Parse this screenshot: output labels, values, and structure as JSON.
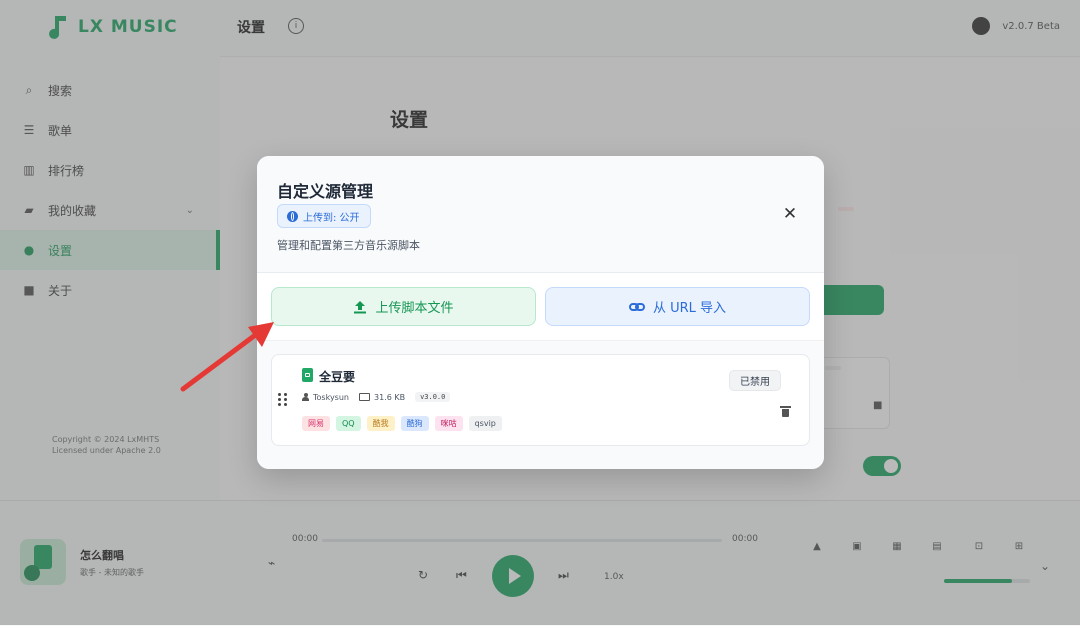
{
  "app": {
    "logo_text": "LX MUSIC",
    "header_title": "设置",
    "version_text": "v2.0.7 Beta"
  },
  "sidebar": {
    "items": [
      {
        "label": "搜索",
        "icon": "search-icon"
      },
      {
        "label": "歌单",
        "icon": "playlist-icon"
      },
      {
        "label": "排行榜",
        "icon": "chart-icon"
      },
      {
        "label": "我的收藏",
        "icon": "folder-icon"
      },
      {
        "label": "设置",
        "icon": "settings-icon"
      },
      {
        "label": "关于",
        "icon": "info-icon"
      }
    ],
    "copyright_line1": "Copyright © 2024 LxMHTS",
    "copyright_line2": "Licensed under Apache 2.0"
  },
  "settings_page": {
    "title": "设置"
  },
  "player": {
    "song_title": "怎么翻唱",
    "singer": "歌手 - 未知的歌手",
    "time_current": "00:00",
    "time_total": "00:00",
    "rate": "1.0x"
  },
  "modal": {
    "title": "自定义源管理",
    "upload_badge": "上传到: 公开",
    "description": "管理和配置第三方音乐源脚本",
    "upload_button": "上传脚本文件",
    "url_button": "从 URL 导入",
    "sources": [
      {
        "name": "全豆要",
        "author": "Toskysun",
        "size": "31.6 KB",
        "version": "v3.0.0",
        "status": "已禁用",
        "tags": [
          {
            "label": "网易",
            "bg": "#fde2e4",
            "fg": "#d6336c"
          },
          {
            "label": "QQ",
            "bg": "#d3f5e1",
            "fg": "#168a4f"
          },
          {
            "label": "酷我",
            "bg": "#fff1c7",
            "fg": "#b7791f"
          },
          {
            "label": "酷狗",
            "bg": "#dbe7fd",
            "fg": "#2b6cd8"
          },
          {
            "label": "咪咕",
            "bg": "#fde2ef",
            "fg": "#c2185b"
          },
          {
            "label": "qsvip",
            "bg": "#eef0f2",
            "fg": "#4b5563"
          }
        ]
      }
    ]
  },
  "colors": {
    "accent": "#22a866",
    "blue": "#2b6cd8",
    "arrow": "#e53935"
  }
}
